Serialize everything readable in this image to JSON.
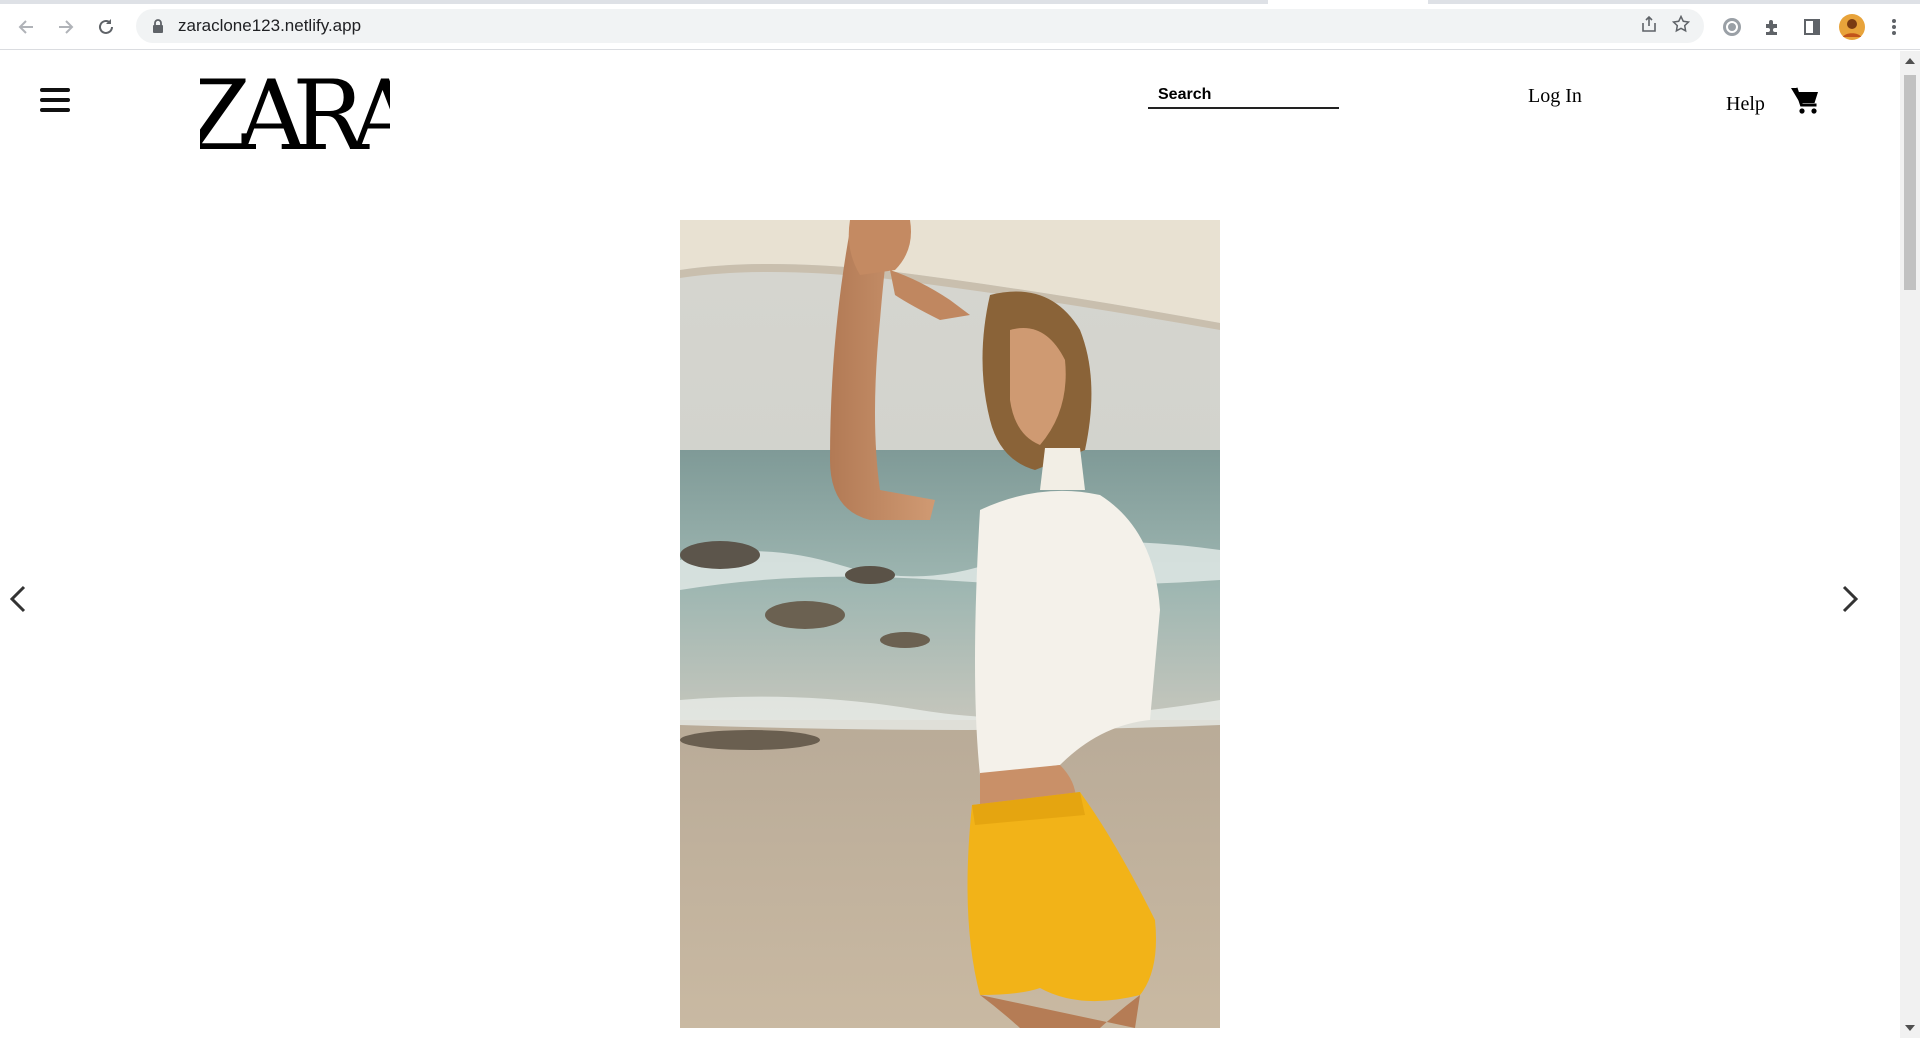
{
  "browser": {
    "url": "zaraclone123.netlify.app",
    "icons": [
      "back-arrow-icon",
      "forward-arrow-icon",
      "reload-icon",
      "lock-icon",
      "share-icon",
      "star-icon",
      "grammarly-icon",
      "extensions-icon",
      "side-panel-icon",
      "profile-avatar",
      "menu-kebab-icon"
    ]
  },
  "header": {
    "brand": "ZARA",
    "search_placeholder": "Search",
    "login_label": "Log In",
    "help_label": "Help"
  },
  "carousel": {
    "image_description_icon": "hero-image",
    "prev_icon": "chevron-left-icon",
    "next_icon": "chevron-right-icon"
  },
  "colors": {
    "text": "#000000",
    "chrome_bg": "#f1f3f4",
    "shorts_yellow": "#f2b318"
  }
}
